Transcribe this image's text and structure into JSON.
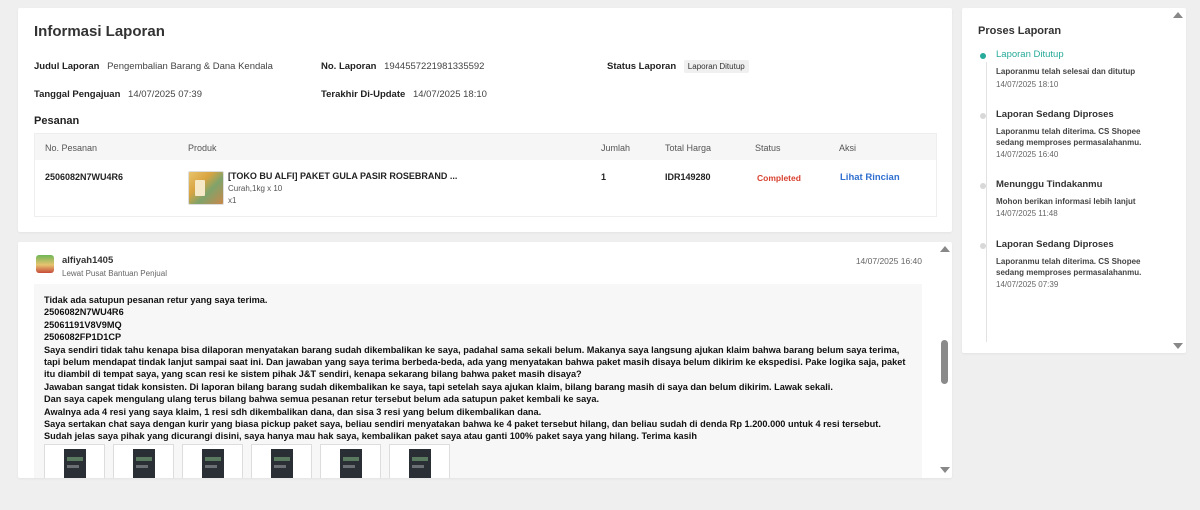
{
  "info": {
    "title": "Informasi Laporan",
    "fields": {
      "judul_label": "Judul Laporan",
      "judul_value": "Pengembalian Barang & Dana Kendala",
      "no_label": "No. Laporan",
      "no_value": "1944557221981335592",
      "status_label": "Status Laporan",
      "status_value": "Laporan Ditutup",
      "tgl_label": "Tanggal Pengajuan",
      "tgl_value": "14/07/2025 07:39",
      "update_label": "Terakhir Di-Update",
      "update_value": "14/07/2025 18:10"
    },
    "pesanan_title": "Pesanan",
    "columns": [
      "No. Pesanan",
      "Produk",
      "Jumlah",
      "Total Harga",
      "Status",
      "Aksi"
    ],
    "order": {
      "no": "2506082N7WU4R6",
      "product_name": "[TOKO BU ALFI] PAKET GULA PASIR ROSEBRAND ...",
      "variant": "Curah,1kg x 10",
      "qty_small": "x1",
      "qty": "1",
      "total": "IDR149280",
      "status": "Completed",
      "action": "Lihat Rincian"
    }
  },
  "thread": {
    "user": "alfiyah1405",
    "via": "Lewat Pusat Bantuan Penjual",
    "time": "14/07/2025 16:40",
    "lines": [
      "Tidak ada satupun pesanan retur yang saya terima.",
      "2506082N7WU4R6",
      "25061191V8V9MQ",
      "2506082FP1D1CP",
      "Saya sendiri tidak tahu kenapa bisa dilaporan menyatakan barang sudah dikembalikan ke saya, padahal sama sekali belum. Makanya saya langsung ajukan klaim bahwa barang belum saya terima, tapi belum mendapat tindak lanjut sampai saat ini. Dan jawaban yang saya terima berbeda-beda, ada yang menyatakan bahwa paket masih disaya belum dikirim ke ekspedisi. Pake logika saja, paket itu diambil di tempat saya, yang scan resi ke sistem pihak J&T sendiri, kenapa sekarang bilang bahwa paket masih disaya?",
      "Jawaban sangat tidak konsisten. Di laporan bilang barang sudah dikembalikan ke saya, tapi setelah saya ajukan klaim, bilang barang masih di saya dan belum dikirim. Lawak sekali.",
      "Dan saya capek mengulang ulang terus bilang bahwa semua pesanan retur tersebut belum ada satupun paket kembali ke saya.",
      "Awalnya ada 4 resi yang saya klaim, 1 resi sdh dikembalikan dana, dan sisa 3 resi yang belum dikembalikan dana.",
      "Saya sertakan chat saya dengan kurir yang biasa pickup paket saya, beliau sendiri menyatakan bahwa ke 4 paket tersebut hilang, dan beliau sudah di denda Rp 1.200.000 untuk 4 resi tersebut.",
      "Sudah jelas saya pihak yang dicurangi disini, saya hanya mau hak saya, kembalikan paket saya atau ganti 100% paket saya yang hilang. Terima kasih"
    ]
  },
  "sidebar": {
    "title": "Proses Laporan",
    "steps": [
      {
        "title": "Laporan Ditutup",
        "desc": "Laporanmu telah selesai dan ditutup",
        "time": "14/07/2025 18:10"
      },
      {
        "title": "Laporan Sedang Diproses",
        "desc": "Laporanmu telah diterima. CS Shopee sedang memproses permasalahanmu.",
        "time": "14/07/2025 16:40"
      },
      {
        "title": "Menunggu Tindakanmu",
        "desc": "Mohon berikan informasi lebih lanjut",
        "time": "14/07/2025 11:48"
      },
      {
        "title": "Laporan Sedang Diproses",
        "desc": "Laporanmu telah diterima. CS Shopee sedang memproses permasalahanmu.",
        "time": "14/07/2025 07:39"
      }
    ]
  }
}
